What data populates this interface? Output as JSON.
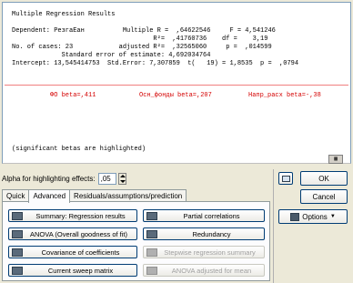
{
  "results": {
    "title": "Multiple Regression Results",
    "lines": [
      "Dependent: РезгаЕан          Multiple R =  ,64622546     F = 4,541246",
      "                                     R²=  ,41760736    df =    3,19",
      "No. of cases: 23            adjusted R²=  ,32565060     p =  ,014599",
      "             Standard error of estimate: 4,692034764",
      "Intercept: 13,545414753  Std.Error: 7,307859  t(   19) = 1,8535  p =  ,0794"
    ],
    "betas": [
      "ФО beta=,411",
      "Осн_фонды beta=,207",
      "Напр_расх beta=-,38"
    ],
    "note": "(significant betas are highlighted)",
    "mini_icon": "grid-icon"
  },
  "alpha": {
    "label": "Alpha for highlighting effects:",
    "value": ",05"
  },
  "tabs": [
    "Quick",
    "Advanced",
    "Residuals/assumptions/prediction"
  ],
  "buttons": {
    "summary": "Summary:  Regression results",
    "partial": "Partial correlations",
    "anova": "ANOVA (Overall goodness of fit)",
    "redundancy": "Redundancy",
    "covariance": "Covariance of coefficients",
    "stepwise": "Stepwise regression summary",
    "sweep": "Current sweep matrix",
    "anova_adj": "ANOVA adjusted for mean"
  },
  "side": {
    "ok": "OK",
    "cancel": "Cancel",
    "options": "Options"
  },
  "colors": {
    "betas": "#d40000",
    "separator": "#f08080",
    "accent": "#003c74"
  }
}
